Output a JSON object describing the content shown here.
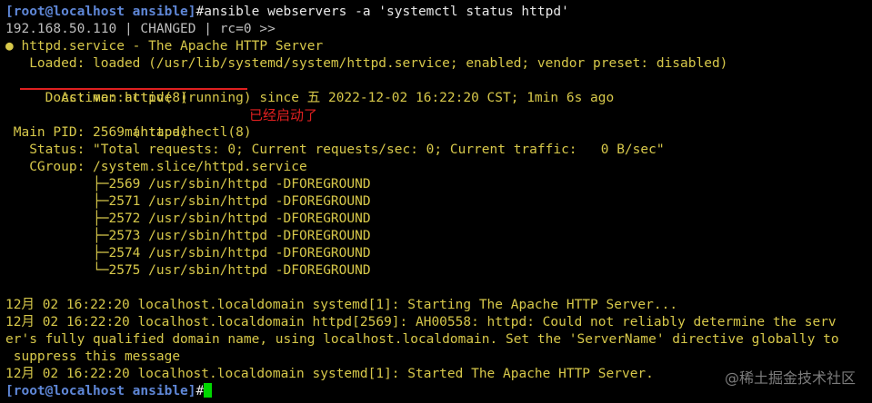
{
  "prompt": "[root@localhost ansible]",
  "command": "#ansible webservers -a 'systemctl status httpd'",
  "result_header": "192.168.50.110 | CHANGED | rc=0 >>",
  "service_dot": "●",
  "service_line": " httpd.service - The Apache HTTP Server",
  "loaded_line": "   Loaded: loaded (/usr/lib/systemd/system/httpd.service; enabled; vendor preset: disabled)",
  "active_line": "   Active: active (running) since 五 2022-12-02 16:22:20 CST; 1min 6s ago",
  "docs_line_1": "     Docs: man:httpd(8)",
  "docs_line_2": "           man:apachectl(8)",
  "annotation": "已经启动了",
  "main_pid_line": " Main PID: 2569 (httpd)",
  "status_line": "   Status: \"Total requests: 0; Current requests/sec: 0; Current traffic:   0 B/sec\"",
  "cgroup_line": "   CGroup: /system.slice/httpd.service",
  "processes": [
    "           ├─2569 /usr/sbin/httpd -DFOREGROUND",
    "           ├─2571 /usr/sbin/httpd -DFOREGROUND",
    "           ├─2572 /usr/sbin/httpd -DFOREGROUND",
    "           ├─2573 /usr/sbin/httpd -DFOREGROUND",
    "           ├─2574 /usr/sbin/httpd -DFOREGROUND",
    "           └─2575 /usr/sbin/httpd -DFOREGROUND"
  ],
  "log_lines": [
    "12月 02 16:22:20 localhost.localdomain systemd[1]: Starting The Apache HTTP Server...",
    "12月 02 16:22:20 localhost.localdomain httpd[2569]: AH00558: httpd: Could not reliably determine the serv",
    "er's fully qualified domain name, using localhost.localdomain. Set the 'ServerName' directive globally to",
    " suppress this message",
    "12月 02 16:22:20 localhost.localdomain systemd[1]: Started The Apache HTTP Server."
  ],
  "final_prompt": "[root@localhost ansible]",
  "final_hash": "#",
  "watermark": "@稀土掘金技术社区",
  "colors": {
    "prompt": "#5f87d7",
    "annotation": "#e02020",
    "cursor": "#00d700",
    "dot": "#d7c84a"
  }
}
